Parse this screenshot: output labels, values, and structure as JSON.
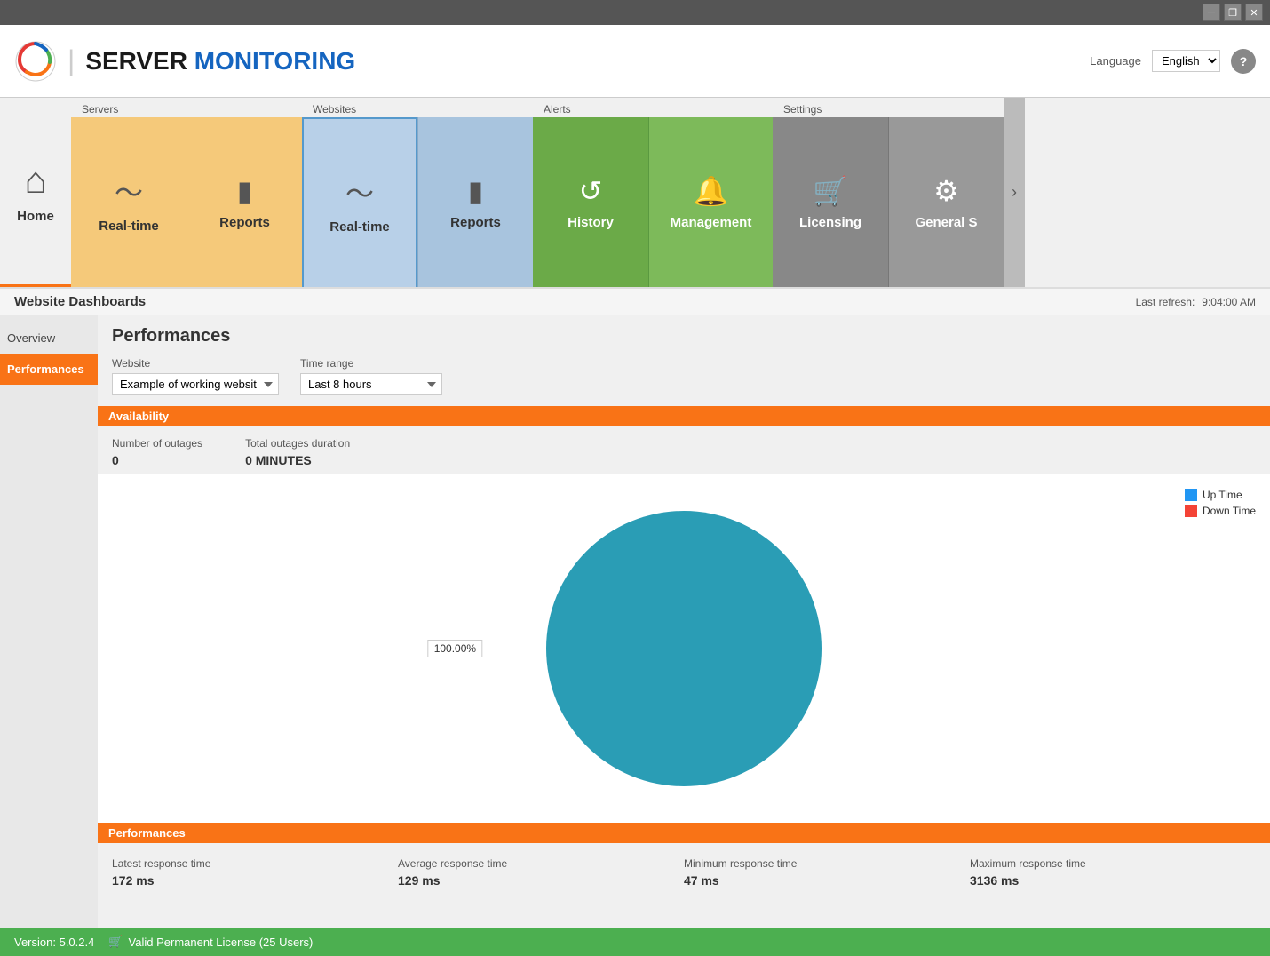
{
  "titleBar": {
    "minimize": "─",
    "restore": "❐",
    "close": "✕"
  },
  "header": {
    "logoText1": "SERVER",
    "logoText2": "MONITORING",
    "languageLabel": "Language",
    "languageValue": "English",
    "helpTitle": "?"
  },
  "nav": {
    "home": {
      "label": "Home",
      "icon": "⌂"
    },
    "groups": [
      {
        "id": "servers",
        "label": "Servers",
        "items": [
          {
            "id": "servers-realtime",
            "label": "Real-time",
            "icon": "〜"
          },
          {
            "id": "servers-reports",
            "label": "Reports",
            "icon": "▮"
          }
        ]
      },
      {
        "id": "websites",
        "label": "Websites",
        "items": [
          {
            "id": "websites-realtime",
            "label": "Real-time",
            "icon": "〜",
            "active": true
          },
          {
            "id": "websites-reports",
            "label": "Reports",
            "icon": "▮"
          }
        ]
      },
      {
        "id": "alerts",
        "label": "Alerts",
        "items": [
          {
            "id": "alerts-history",
            "label": "History",
            "icon": "↺"
          },
          {
            "id": "alerts-management",
            "label": "Management",
            "icon": "🔔"
          }
        ]
      },
      {
        "id": "settings",
        "label": "Settings",
        "items": [
          {
            "id": "settings-licensing",
            "label": "Licensing",
            "icon": "🛒"
          },
          {
            "id": "settings-general",
            "label": "General S",
            "icon": ""
          }
        ]
      }
    ]
  },
  "contentHeader": {
    "title": "Website Dashboards",
    "lastRefreshLabel": "Last refresh:",
    "lastRefreshTime": "9:04:00 AM"
  },
  "sidebar": {
    "items": [
      {
        "id": "overview",
        "label": "Overview"
      },
      {
        "id": "performances",
        "label": "Performances",
        "active": true
      }
    ]
  },
  "panel": {
    "title": "Performances",
    "websiteLabel": "Website",
    "websiteValue": "Example of working websit",
    "timeRangeLabel": "Time range",
    "timeRangeValue": "Last 8 hours",
    "availability": {
      "sectionLabel": "Availability",
      "outagesLabel": "Number of outages",
      "outagesValue": "0",
      "durationLabel": "Total outages duration",
      "durationValue": "0 MINUTES"
    },
    "chart": {
      "upTimeLabel": "Up Time",
      "downTimeLabel": "Down Time",
      "upTimeColor": "#2196F3",
      "downTimeColor": "#f44336",
      "pieColor": "#2a9db5",
      "percentLabel": "100.00%"
    },
    "performances": {
      "sectionLabel": "Performances",
      "stats": [
        {
          "id": "latest",
          "label": "Latest response time",
          "value": "172 ms"
        },
        {
          "id": "average",
          "label": "Average response time",
          "value": "129 ms"
        },
        {
          "id": "minimum",
          "label": "Minimum response time",
          "value": "47 ms"
        },
        {
          "id": "maximum",
          "label": "Maximum response time",
          "value": "3136 ms"
        }
      ]
    }
  },
  "statusBar": {
    "version": "Version: 5.0.2.4",
    "cartIcon": "🛒",
    "licenseText": "Valid Permanent License (25 Users)"
  }
}
